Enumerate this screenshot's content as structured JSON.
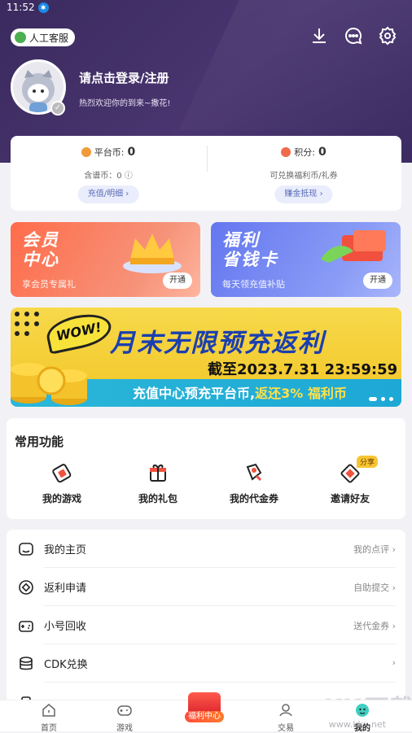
{
  "status": {
    "time": "11:52"
  },
  "header": {
    "service_label": "人工客服",
    "user_name": "请点击登录/注册",
    "welcome": "热烈欢迎你的到来~撒花!"
  },
  "wallet": {
    "platform_coin_label": "平台币:",
    "platform_coin_value": "0",
    "points_label": "积分:",
    "points_value": "0",
    "gift_coin_text": "含谱币：0",
    "exchange_text": "可兑换福利币/礼券",
    "recharge_button": "充值/明细 ›",
    "earn_button": "赚金抵现 ›"
  },
  "cards": [
    {
      "title_line1": "会员",
      "title_line2": "中心",
      "subtitle": "享会员专属礼",
      "button": "开通",
      "color": "#f86a4d"
    },
    {
      "title_line1": "福利",
      "title_line2": "省钱卡",
      "subtitle": "每天领充值补贴",
      "button": "开通",
      "color": "#6f82f0"
    }
  ],
  "banner": {
    "wow": "WOW!",
    "headline": "月末无限预充返利",
    "deadline": "截至2023.7.31  23:59:59",
    "bottom_text": "充值中心预充平台币,",
    "bottom_highlight": "返还3% 福利币"
  },
  "functions": {
    "title": "常用功能",
    "items": [
      {
        "label": "我的游戏",
        "icon": "game-card-icon"
      },
      {
        "label": "我的礼包",
        "icon": "gift-icon"
      },
      {
        "label": "我的代金券",
        "icon": "voucher-icon"
      },
      {
        "label": "邀请好友",
        "icon": "invite-icon",
        "badge": "分享"
      }
    ]
  },
  "menu": [
    {
      "label": "我的主页",
      "right": "我的点评",
      "icon": "home-page-icon"
    },
    {
      "label": "返利申请",
      "right": "自助提交",
      "icon": "rebate-icon"
    },
    {
      "label": "小号回收",
      "right": "送代金券",
      "icon": "recycle-icon"
    },
    {
      "label": "CDK兑换",
      "right": "",
      "icon": "cdk-icon"
    },
    {
      "label": "",
      "right": "",
      "icon": "partial-icon"
    }
  ],
  "tabbar": [
    {
      "label": "首页"
    },
    {
      "label": "游戏"
    },
    {
      "label": "福利中心"
    },
    {
      "label": "交易"
    },
    {
      "label": "我的"
    }
  ],
  "watermark": {
    "main": "KK下载",
    "sub": "www.kkx.net"
  }
}
